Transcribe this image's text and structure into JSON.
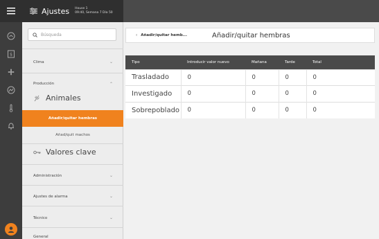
{
  "app": {
    "title": "Ajustes",
    "house": "House 1",
    "time_info": "09:40, Semana 7 Día 50"
  },
  "search": {
    "placeholder": "Búsqueda"
  },
  "sidebar": {
    "clima": "Clima",
    "produccion": "Producción",
    "animales": "Animales",
    "add_females": "Añadir/quitar hembras",
    "add_males": "Añad/quit machos",
    "valores_clave": "Valores clave",
    "administracion": "Administración",
    "alarma": "Ajustes de alarma",
    "tecnico": "Técnico",
    "general": "General"
  },
  "main": {
    "breadcrumb": "Añadir/quitar hemb...",
    "title": "Añadir/quitar hembras",
    "columns": [
      "Tipo",
      "Introducir valor nuevo",
      "Mañana",
      "Tarde",
      "Total"
    ],
    "rows": [
      [
        "Trasladado",
        "0",
        "0",
        "0",
        "0"
      ],
      [
        "Investigado",
        "0",
        "0",
        "0",
        "0"
      ],
      [
        "Sobrepoblado",
        "0",
        "0",
        "0",
        "0"
      ]
    ]
  },
  "colors": {
    "accent": "#f0821e",
    "dark": "#3d3d3d",
    "header": "#4a4a4a"
  }
}
